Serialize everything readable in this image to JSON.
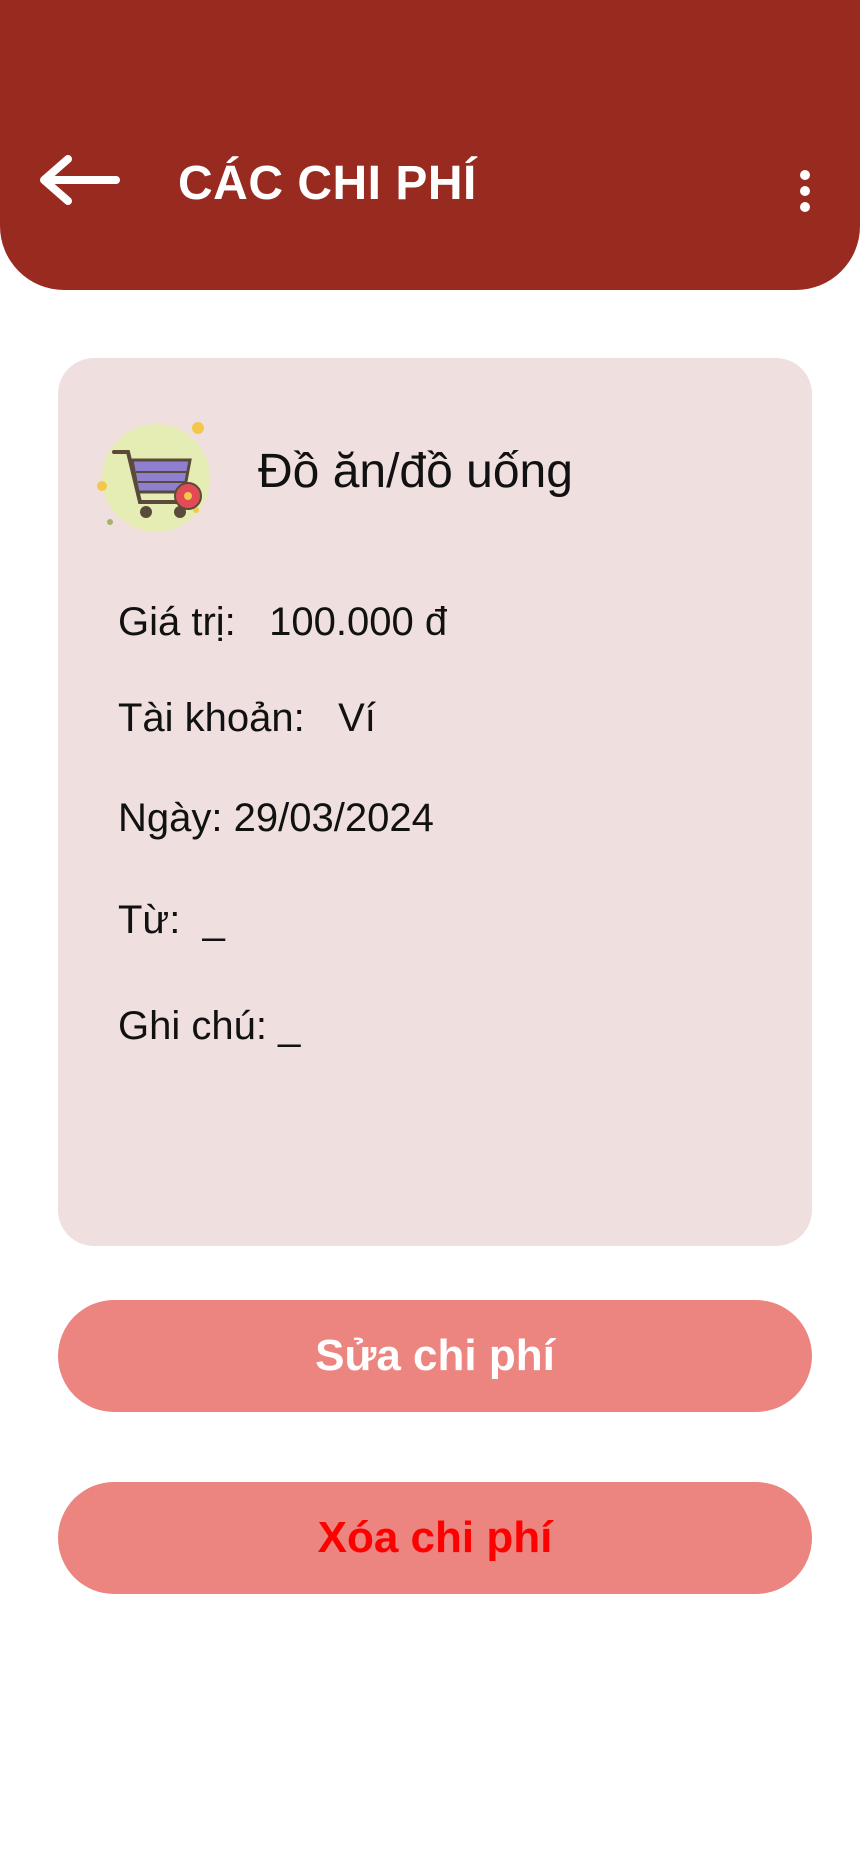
{
  "header": {
    "title": "CÁC CHI PHÍ",
    "background": "#992a20"
  },
  "expense": {
    "category": "Đồ ăn/đồ uống",
    "category_icon": "shopping-cart-icon",
    "value_label": "Giá trị:",
    "value": "100.000 đ",
    "account_label": "Tài khoản:",
    "account": "Ví",
    "date_label": "Ngày:",
    "date": "29/03/2024",
    "from_label": "Từ:",
    "from": "_",
    "note_label": "Ghi chú:",
    "note": "_"
  },
  "actions": {
    "edit_label": "Sửa chi phí",
    "delete_label": "Xóa chi phí"
  },
  "colors": {
    "card_bg": "#f0dfdf",
    "button_bg": "#ec8480",
    "delete_text": "#ff0000"
  }
}
